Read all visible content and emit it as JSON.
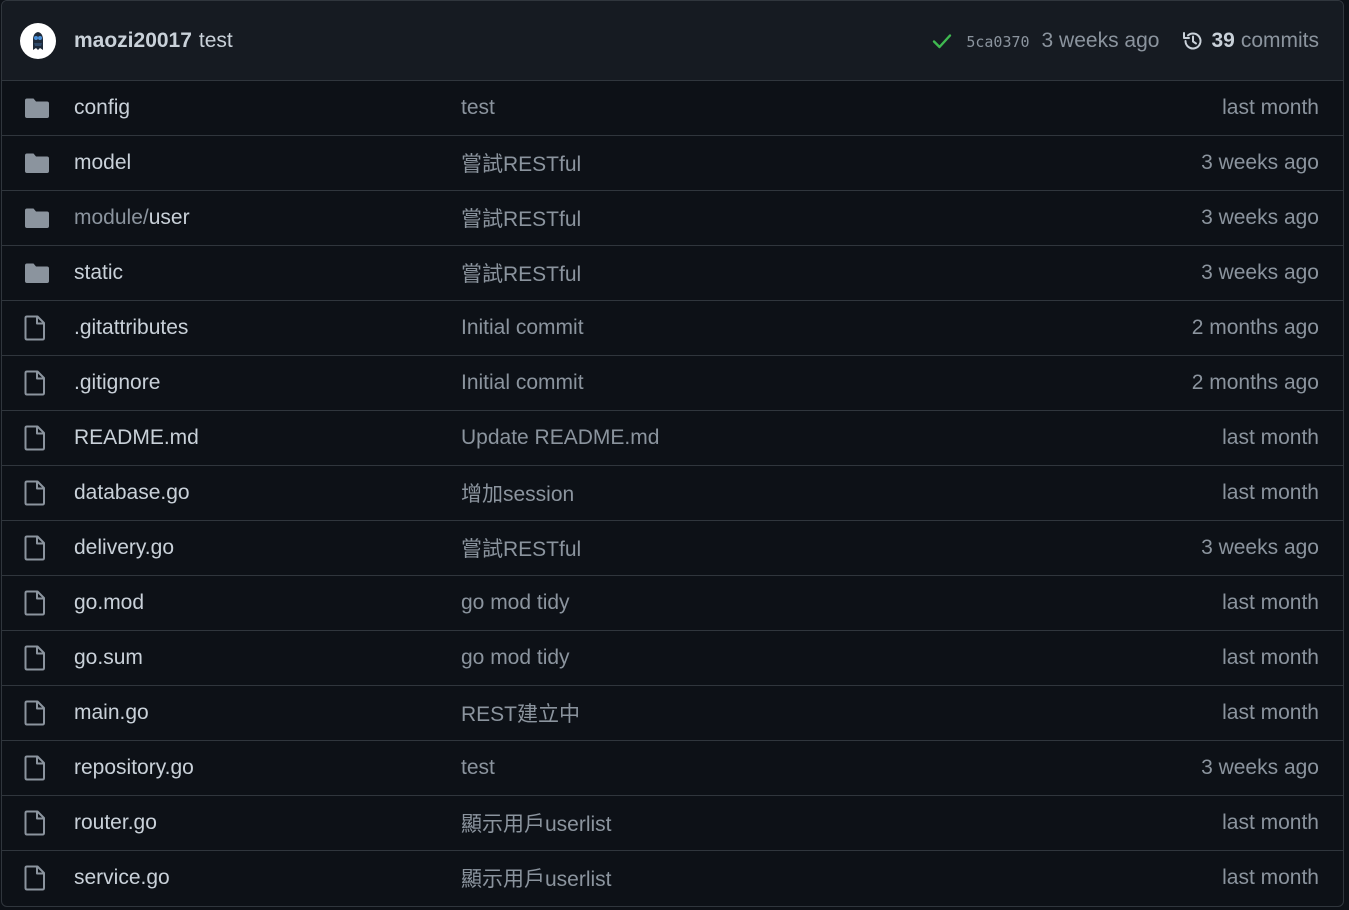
{
  "header": {
    "author": "maozi20017",
    "message": "test",
    "sha": "5ca0370",
    "age": "3 weeks ago",
    "commit_count": "39",
    "commit_count_label": "commits",
    "status_icon": "check-icon",
    "status_color": "#3fb950"
  },
  "files": [
    {
      "type": "folder",
      "name_prefix": "",
      "name": "config",
      "message": "test",
      "age": "last month"
    },
    {
      "type": "folder",
      "name_prefix": "",
      "name": "model",
      "message": "嘗試RESTful",
      "age": "3 weeks ago"
    },
    {
      "type": "folder",
      "name_prefix": "module/",
      "name": "user",
      "message": "嘗試RESTful",
      "age": "3 weeks ago"
    },
    {
      "type": "folder",
      "name_prefix": "",
      "name": "static",
      "message": "嘗試RESTful",
      "age": "3 weeks ago"
    },
    {
      "type": "file",
      "name_prefix": "",
      "name": ".gitattributes",
      "message": "Initial commit",
      "age": "2 months ago"
    },
    {
      "type": "file",
      "name_prefix": "",
      "name": ".gitignore",
      "message": "Initial commit",
      "age": "2 months ago"
    },
    {
      "type": "file",
      "name_prefix": "",
      "name": "README.md",
      "message": "Update README.md",
      "age": "last month"
    },
    {
      "type": "file",
      "name_prefix": "",
      "name": "database.go",
      "message": "增加session",
      "age": "last month"
    },
    {
      "type": "file",
      "name_prefix": "",
      "name": "delivery.go",
      "message": "嘗試RESTful",
      "age": "3 weeks ago"
    },
    {
      "type": "file",
      "name_prefix": "",
      "name": "go.mod",
      "message": "go mod tidy",
      "age": "last month"
    },
    {
      "type": "file",
      "name_prefix": "",
      "name": "go.sum",
      "message": "go mod tidy",
      "age": "last month"
    },
    {
      "type": "file",
      "name_prefix": "",
      "name": "main.go",
      "message": "REST建立中",
      "age": "last month"
    },
    {
      "type": "file",
      "name_prefix": "",
      "name": "repository.go",
      "message": "test",
      "age": "3 weeks ago"
    },
    {
      "type": "file",
      "name_prefix": "",
      "name": "router.go",
      "message": "顯示用戶userlist",
      "age": "last month"
    },
    {
      "type": "file",
      "name_prefix": "",
      "name": "service.go",
      "message": "顯示用戶userlist",
      "age": "last month"
    }
  ],
  "colors": {
    "folder": "#8b949e",
    "file": "#8b949e",
    "background": "#0d1117",
    "header_background": "#161b22",
    "border": "#30363d"
  }
}
